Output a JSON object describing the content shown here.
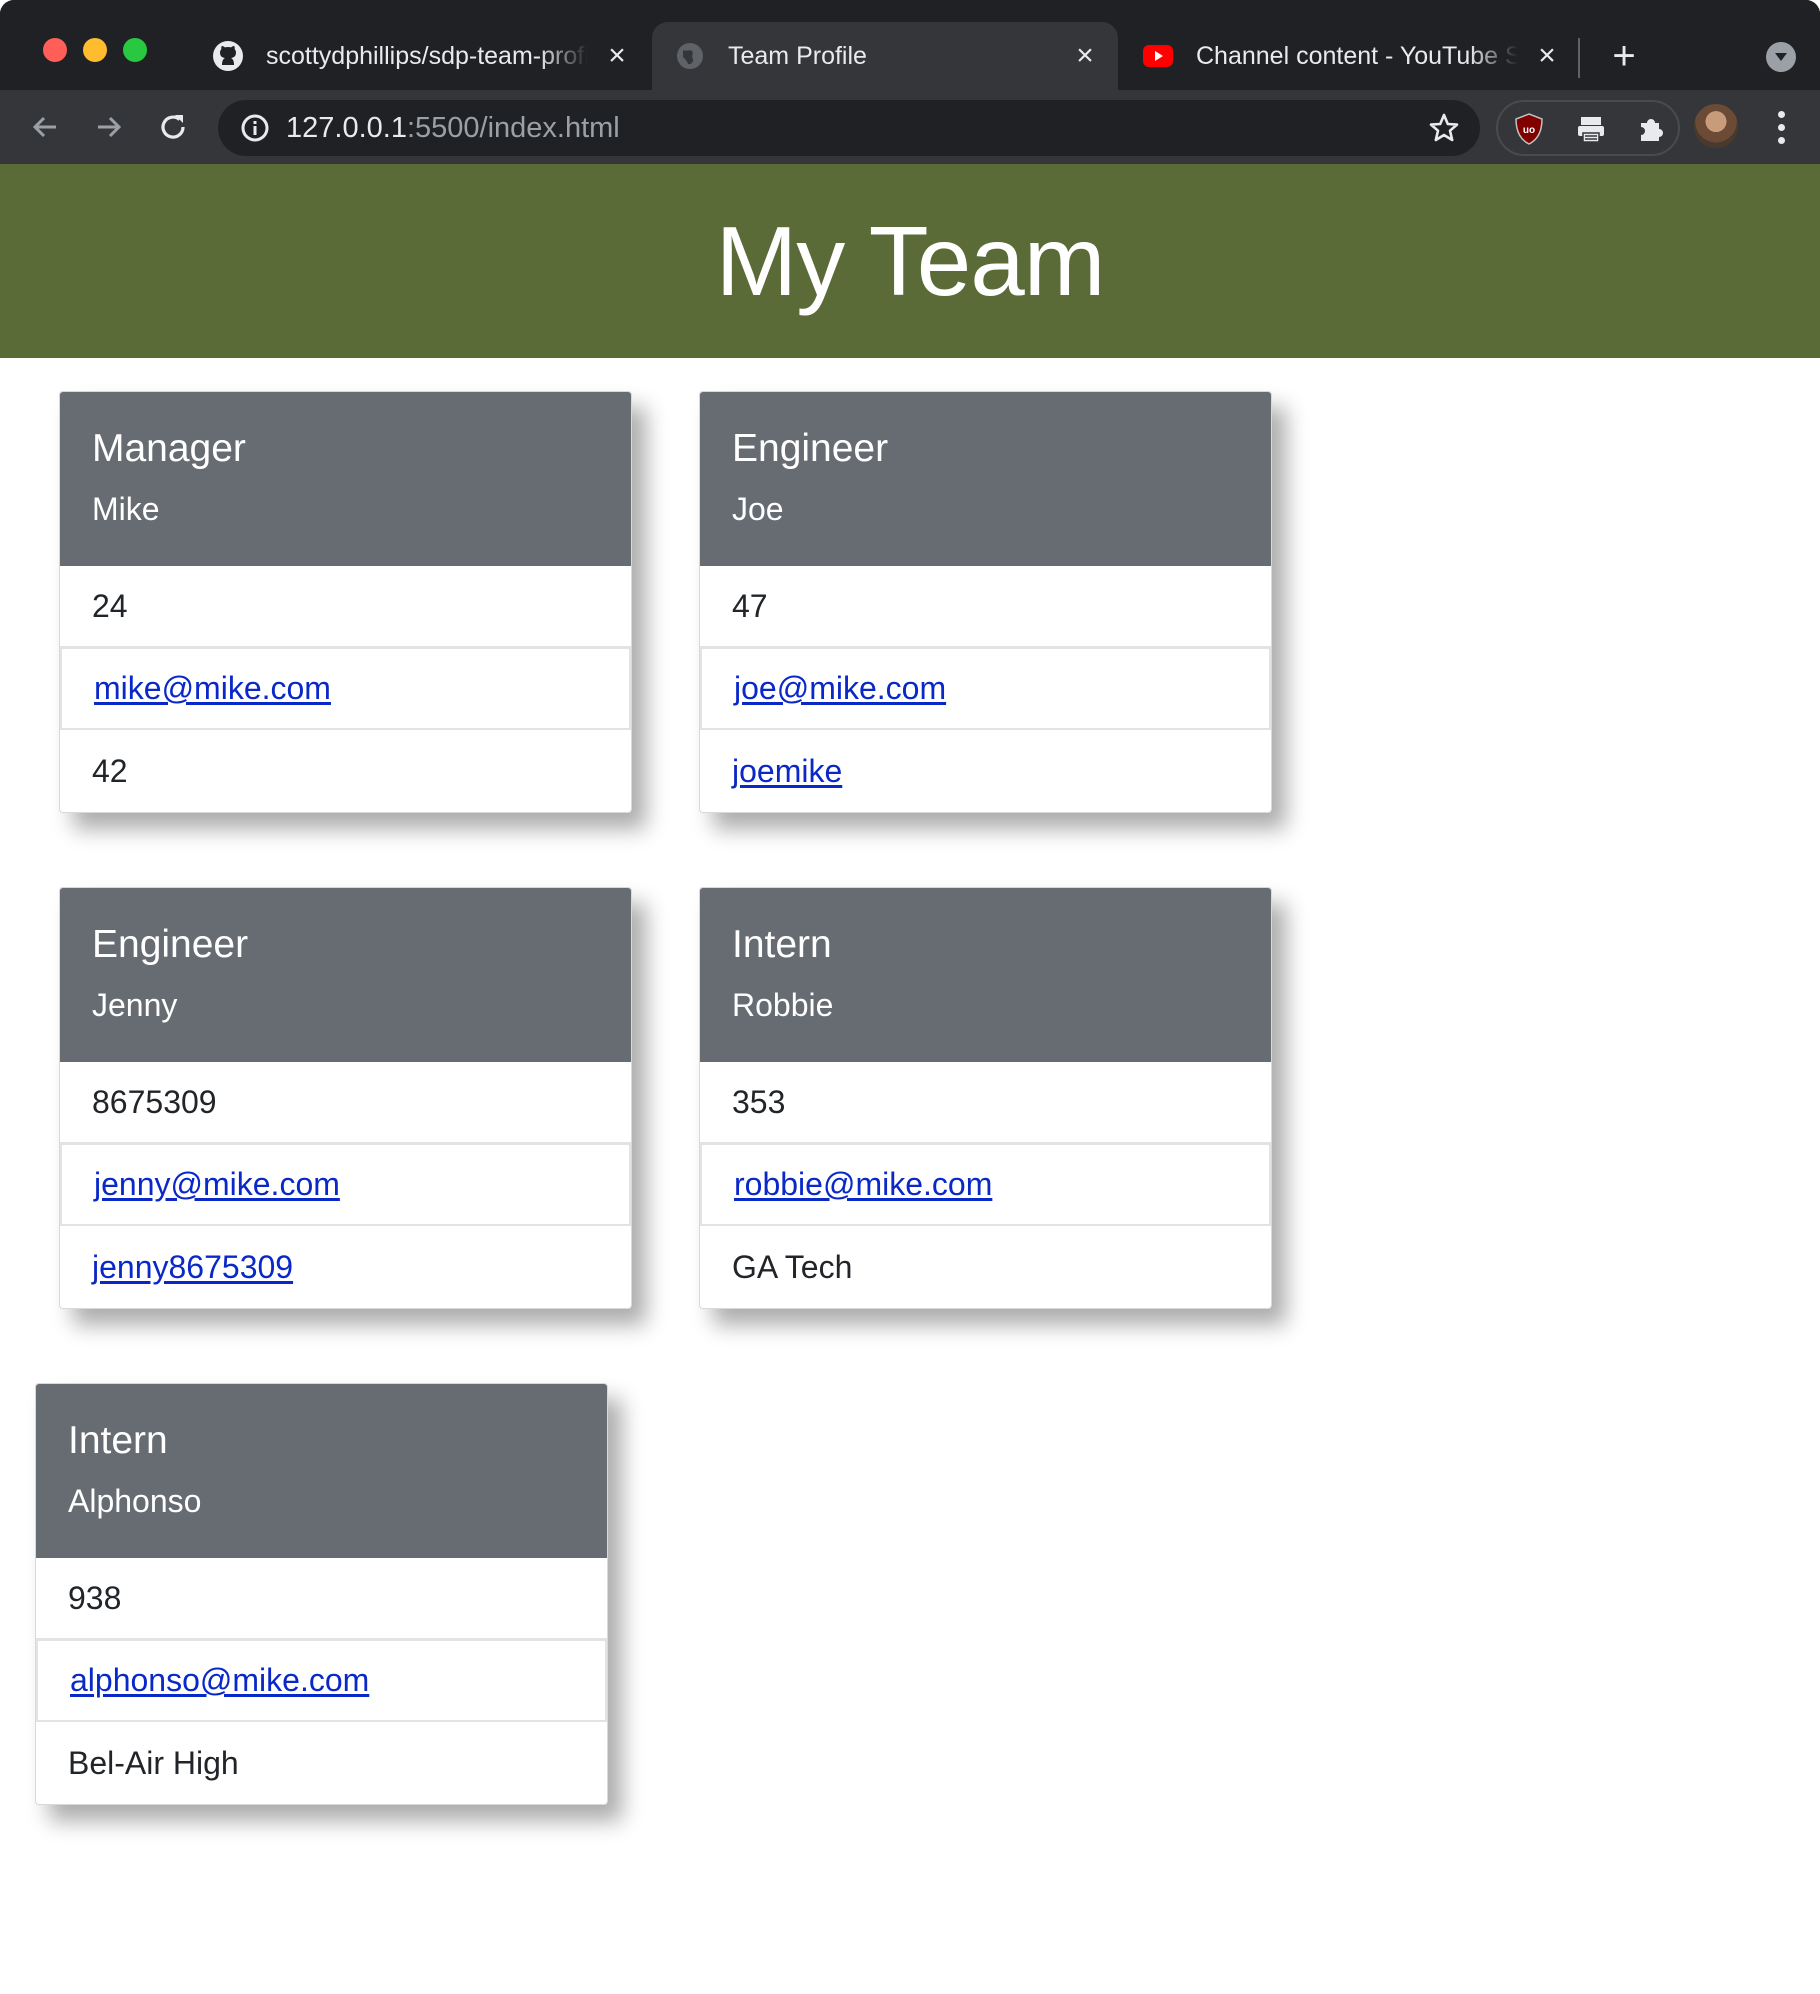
{
  "browser": {
    "tabs": [
      {
        "label": "scottydphillips/sdp-team-profile",
        "favicon": "github-icon"
      },
      {
        "label": "Team Profile",
        "favicon": "globe-icon",
        "active": true
      },
      {
        "label": "Channel content - YouTube Studio",
        "favicon": "youtube-icon"
      }
    ],
    "url_host": "127.0.0.1",
    "url_rest": ":5500/index.html"
  },
  "page": {
    "heading": "My Team",
    "colors": {
      "banner": "#5a6b38",
      "card_header": "#676c73",
      "link": "#0a28c8"
    },
    "cards": [
      {
        "role": "Manager",
        "name": "Mike",
        "id": "24",
        "email": "mike@mike.com",
        "extra": "42"
      },
      {
        "role": "Engineer",
        "name": "Joe",
        "id": "47",
        "email": "joe@mike.com",
        "extra": "joemike"
      },
      {
        "role": "Engineer",
        "name": "Jenny",
        "id": "8675309",
        "email": "jenny@mike.com",
        "extra": "jenny8675309"
      },
      {
        "role": "Intern",
        "name": "Robbie",
        "id": "353",
        "email": "robbie@mike.com",
        "extra": "GA Tech"
      },
      {
        "role": "Intern",
        "name": "Alphonso",
        "id": "938",
        "email": "alphonso@mike.com",
        "extra": "Bel-Air High"
      }
    ]
  }
}
